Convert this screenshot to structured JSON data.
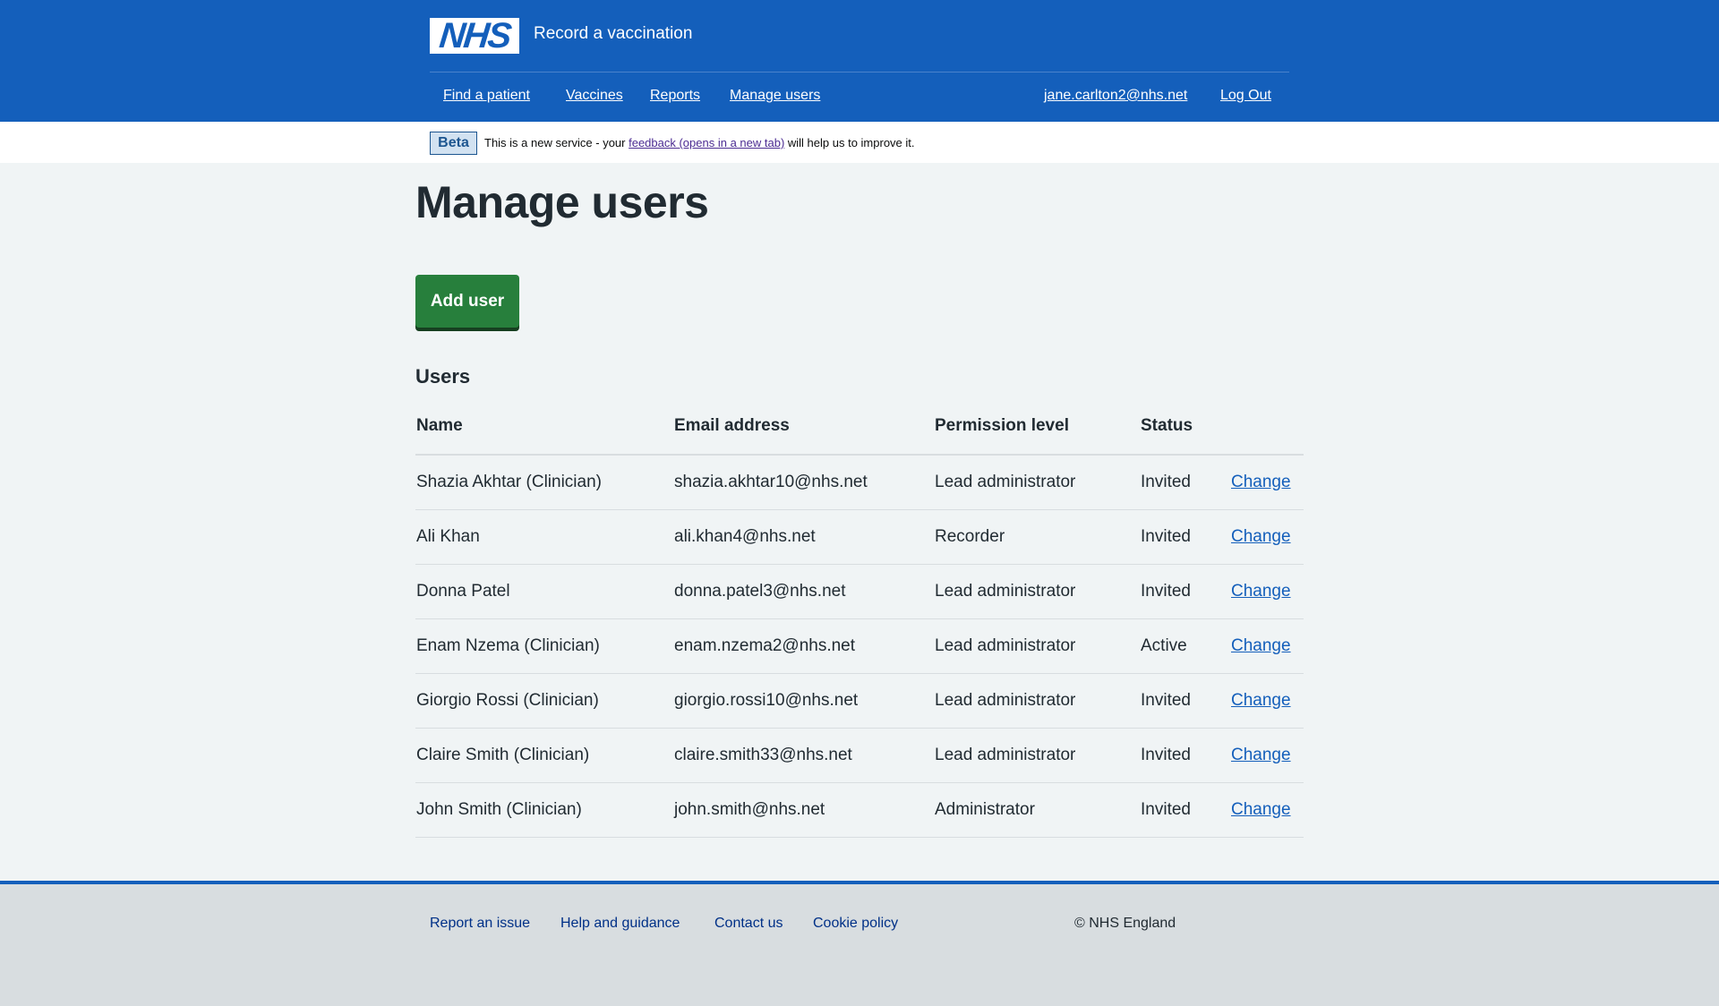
{
  "header": {
    "logo_text": "NHS",
    "service_name": "Record a vaccination",
    "nav": [
      {
        "label": "Find a patient"
      },
      {
        "label": "Vaccines"
      },
      {
        "label": "Reports"
      },
      {
        "label": "Manage users"
      }
    ],
    "user_email": "jane.carlton2@nhs.net",
    "logout_label": "Log Out"
  },
  "beta": {
    "tag": "Beta",
    "text_before": "This is a new service - your ",
    "link_text": "feedback (opens in a new tab)",
    "text_after": " will help us to improve it."
  },
  "main": {
    "title": "Manage users",
    "add_user_label": "Add user",
    "table_caption": "Users",
    "columns": [
      "Name",
      "Email address",
      "Permission level",
      "Status"
    ],
    "rows": [
      {
        "name": "Shazia Akhtar (Clinician)",
        "email": "shazia.akhtar10@nhs.net",
        "permission": "Lead administrator",
        "status": "Invited",
        "action": "Change"
      },
      {
        "name": "Ali Khan",
        "email": "ali.khan4@nhs.net",
        "permission": "Recorder",
        "status": "Invited",
        "action": "Change"
      },
      {
        "name": "Donna Patel",
        "email": "donna.patel3@nhs.net",
        "permission": "Lead administrator",
        "status": "Invited",
        "action": "Change"
      },
      {
        "name": "Enam Nzema (Clinician)",
        "email": "enam.nzema2@nhs.net",
        "permission": "Lead administrator",
        "status": "Active",
        "action": "Change"
      },
      {
        "name": "Giorgio Rossi (Clinician)",
        "email": "giorgio.rossi10@nhs.net",
        "permission": "Lead administrator",
        "status": "Invited",
        "action": "Change"
      },
      {
        "name": "Claire Smith (Clinician)",
        "email": "claire.smith33@nhs.net",
        "permission": "Lead administrator",
        "status": "Invited",
        "action": "Change"
      },
      {
        "name": "John Smith (Clinician)",
        "email": "john.smith@nhs.net",
        "permission": "Administrator",
        "status": "Invited",
        "action": "Change"
      }
    ]
  },
  "footer": {
    "links": [
      {
        "label": "Report an issue"
      },
      {
        "label": "Help and guidance"
      },
      {
        "label": "Contact us"
      },
      {
        "label": "Cookie policy"
      }
    ],
    "copyright": "© NHS England"
  },
  "colors": {
    "brand_blue": "#145fbb",
    "button_green": "#277f3c",
    "page_bg": "#f0f4f5",
    "footer_bg": "#d8dde0",
    "text": "#212b32"
  }
}
